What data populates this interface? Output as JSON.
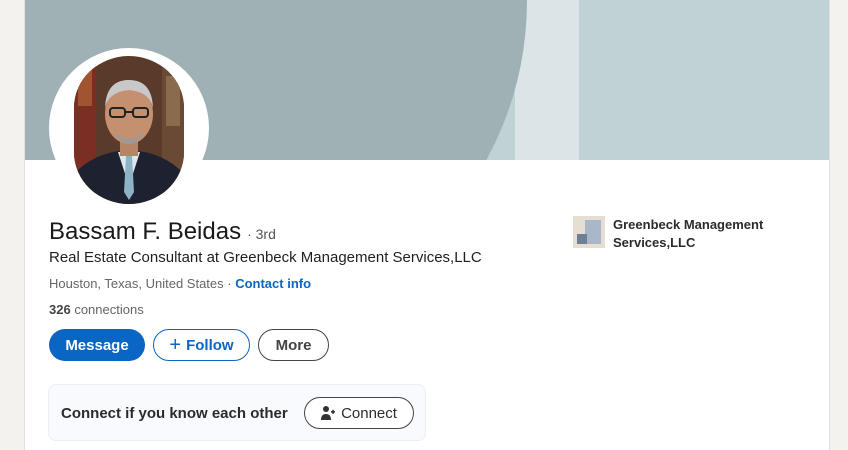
{
  "profile": {
    "name": "Bassam F. Beidas",
    "degree": "· 3rd",
    "headline": "Real Estate Consultant at Greenbeck Management Services,LLC",
    "location": "Houston, Texas, United States ·",
    "contact_info": "Contact info",
    "connections_count": "326",
    "connections_label": "connections"
  },
  "actions": {
    "message": "Message",
    "follow": "Follow",
    "more": "More"
  },
  "connect_prompt": {
    "text": "Connect if you know each other",
    "button": "Connect"
  },
  "company": {
    "name": "Greenbeck Management Services,LLC"
  },
  "icons": {
    "follow": "plus-icon",
    "connect": "person-add-icon",
    "company": "company-logo-icon"
  },
  "colors": {
    "accent": "#0a66c2",
    "banner": "#9fb1b4"
  }
}
